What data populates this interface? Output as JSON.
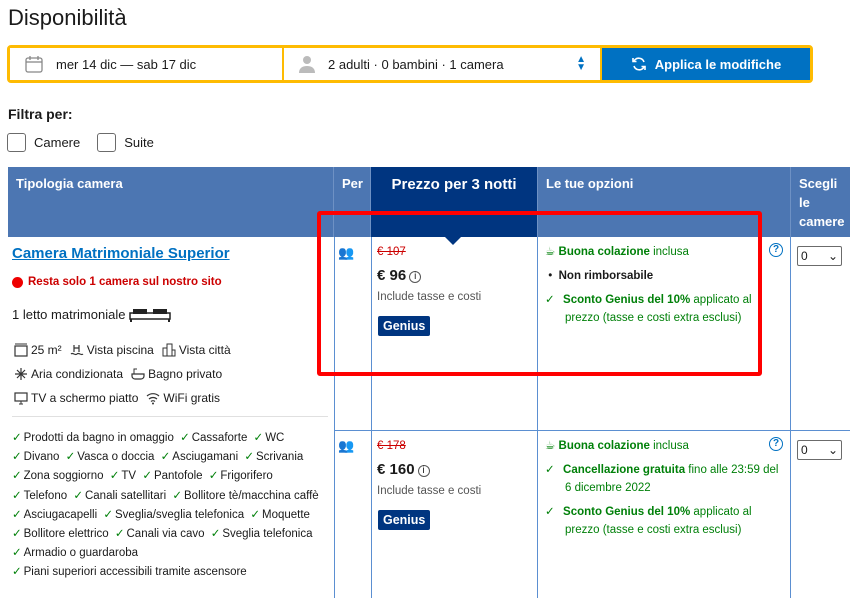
{
  "page": {
    "title": "Disponibilità"
  },
  "search": {
    "dates": "mer 14 dic — sab 17 dic",
    "guests": "2 adulti · 0 bambini · 1 camera",
    "apply_label": "Applica le modifiche"
  },
  "filters": {
    "title": "Filtra per:",
    "options": [
      "Camere",
      "Suite"
    ]
  },
  "table": {
    "headers": [
      "Tipologia camera",
      "Per",
      "Prezzo per 3 notti",
      "Le tue opzioni",
      "Scegli le camere"
    ],
    "room": {
      "name": "Camera Matrimoniale Superior",
      "scarcity": "Resta solo 1 camera sul nostro sito",
      "bed": "1 letto matrimoniale",
      "facilities": [
        [
          "25 m²",
          "Vista piscina",
          "Vista città"
        ],
        [
          "Aria condizionata",
          "Bagno privato"
        ],
        [
          "TV a schermo piatto",
          "WiFi gratis"
        ]
      ],
      "amenities": [
        "Prodotti da bagno in omaggio",
        "Cassaforte",
        "WC",
        "Divano",
        "Vasca o doccia",
        "Asciugamani",
        "Scrivania",
        "Zona soggiorno",
        "TV",
        "Pantofole",
        "Frigorifero",
        "Telefono",
        "Canali satellitari",
        "Bollitore tè/macchina caffè",
        "Asciugacapelli",
        "Sveglia/sveglia telefonica",
        "Moquette",
        "Bollitore elettrico",
        "Canali via cavo",
        "Sveglia telefonica",
        "Armadio o guardaroba",
        "Piani superiori accessibili tramite ascensore"
      ]
    },
    "offers": [
      {
        "old_price": "€ 107",
        "price": "€ 96",
        "tax_note": "Include tasse e costi",
        "badge": "Genius",
        "breakfast": "Buona colazione",
        "breakfast_suffix": "inclusa",
        "policy": "Non rimborsabile",
        "discount": "Sconto Genius del 10%",
        "discount_suffix": "applicato al prezzo (tasse e costi extra esclusi)",
        "qty": "0"
      },
      {
        "old_price": "€ 178",
        "price": "€ 160",
        "tax_note": "Include tasse e costi",
        "badge": "Genius",
        "breakfast": "Buona colazione",
        "breakfast_suffix": "inclusa",
        "policy": "Cancellazione gratuita",
        "policy_suffix": "fino alle 23:59 del 6 dicembre 2022",
        "discount": "Sconto Genius del 10%",
        "discount_suffix": "applicato al prezzo (tasse e costi extra esclusi)",
        "qty": "0"
      }
    ]
  },
  "colors": {
    "accent": "#0071c2",
    "header": "#4c76b2",
    "price_header": "#003580",
    "highlight": "#ff0000",
    "green": "#008009"
  }
}
